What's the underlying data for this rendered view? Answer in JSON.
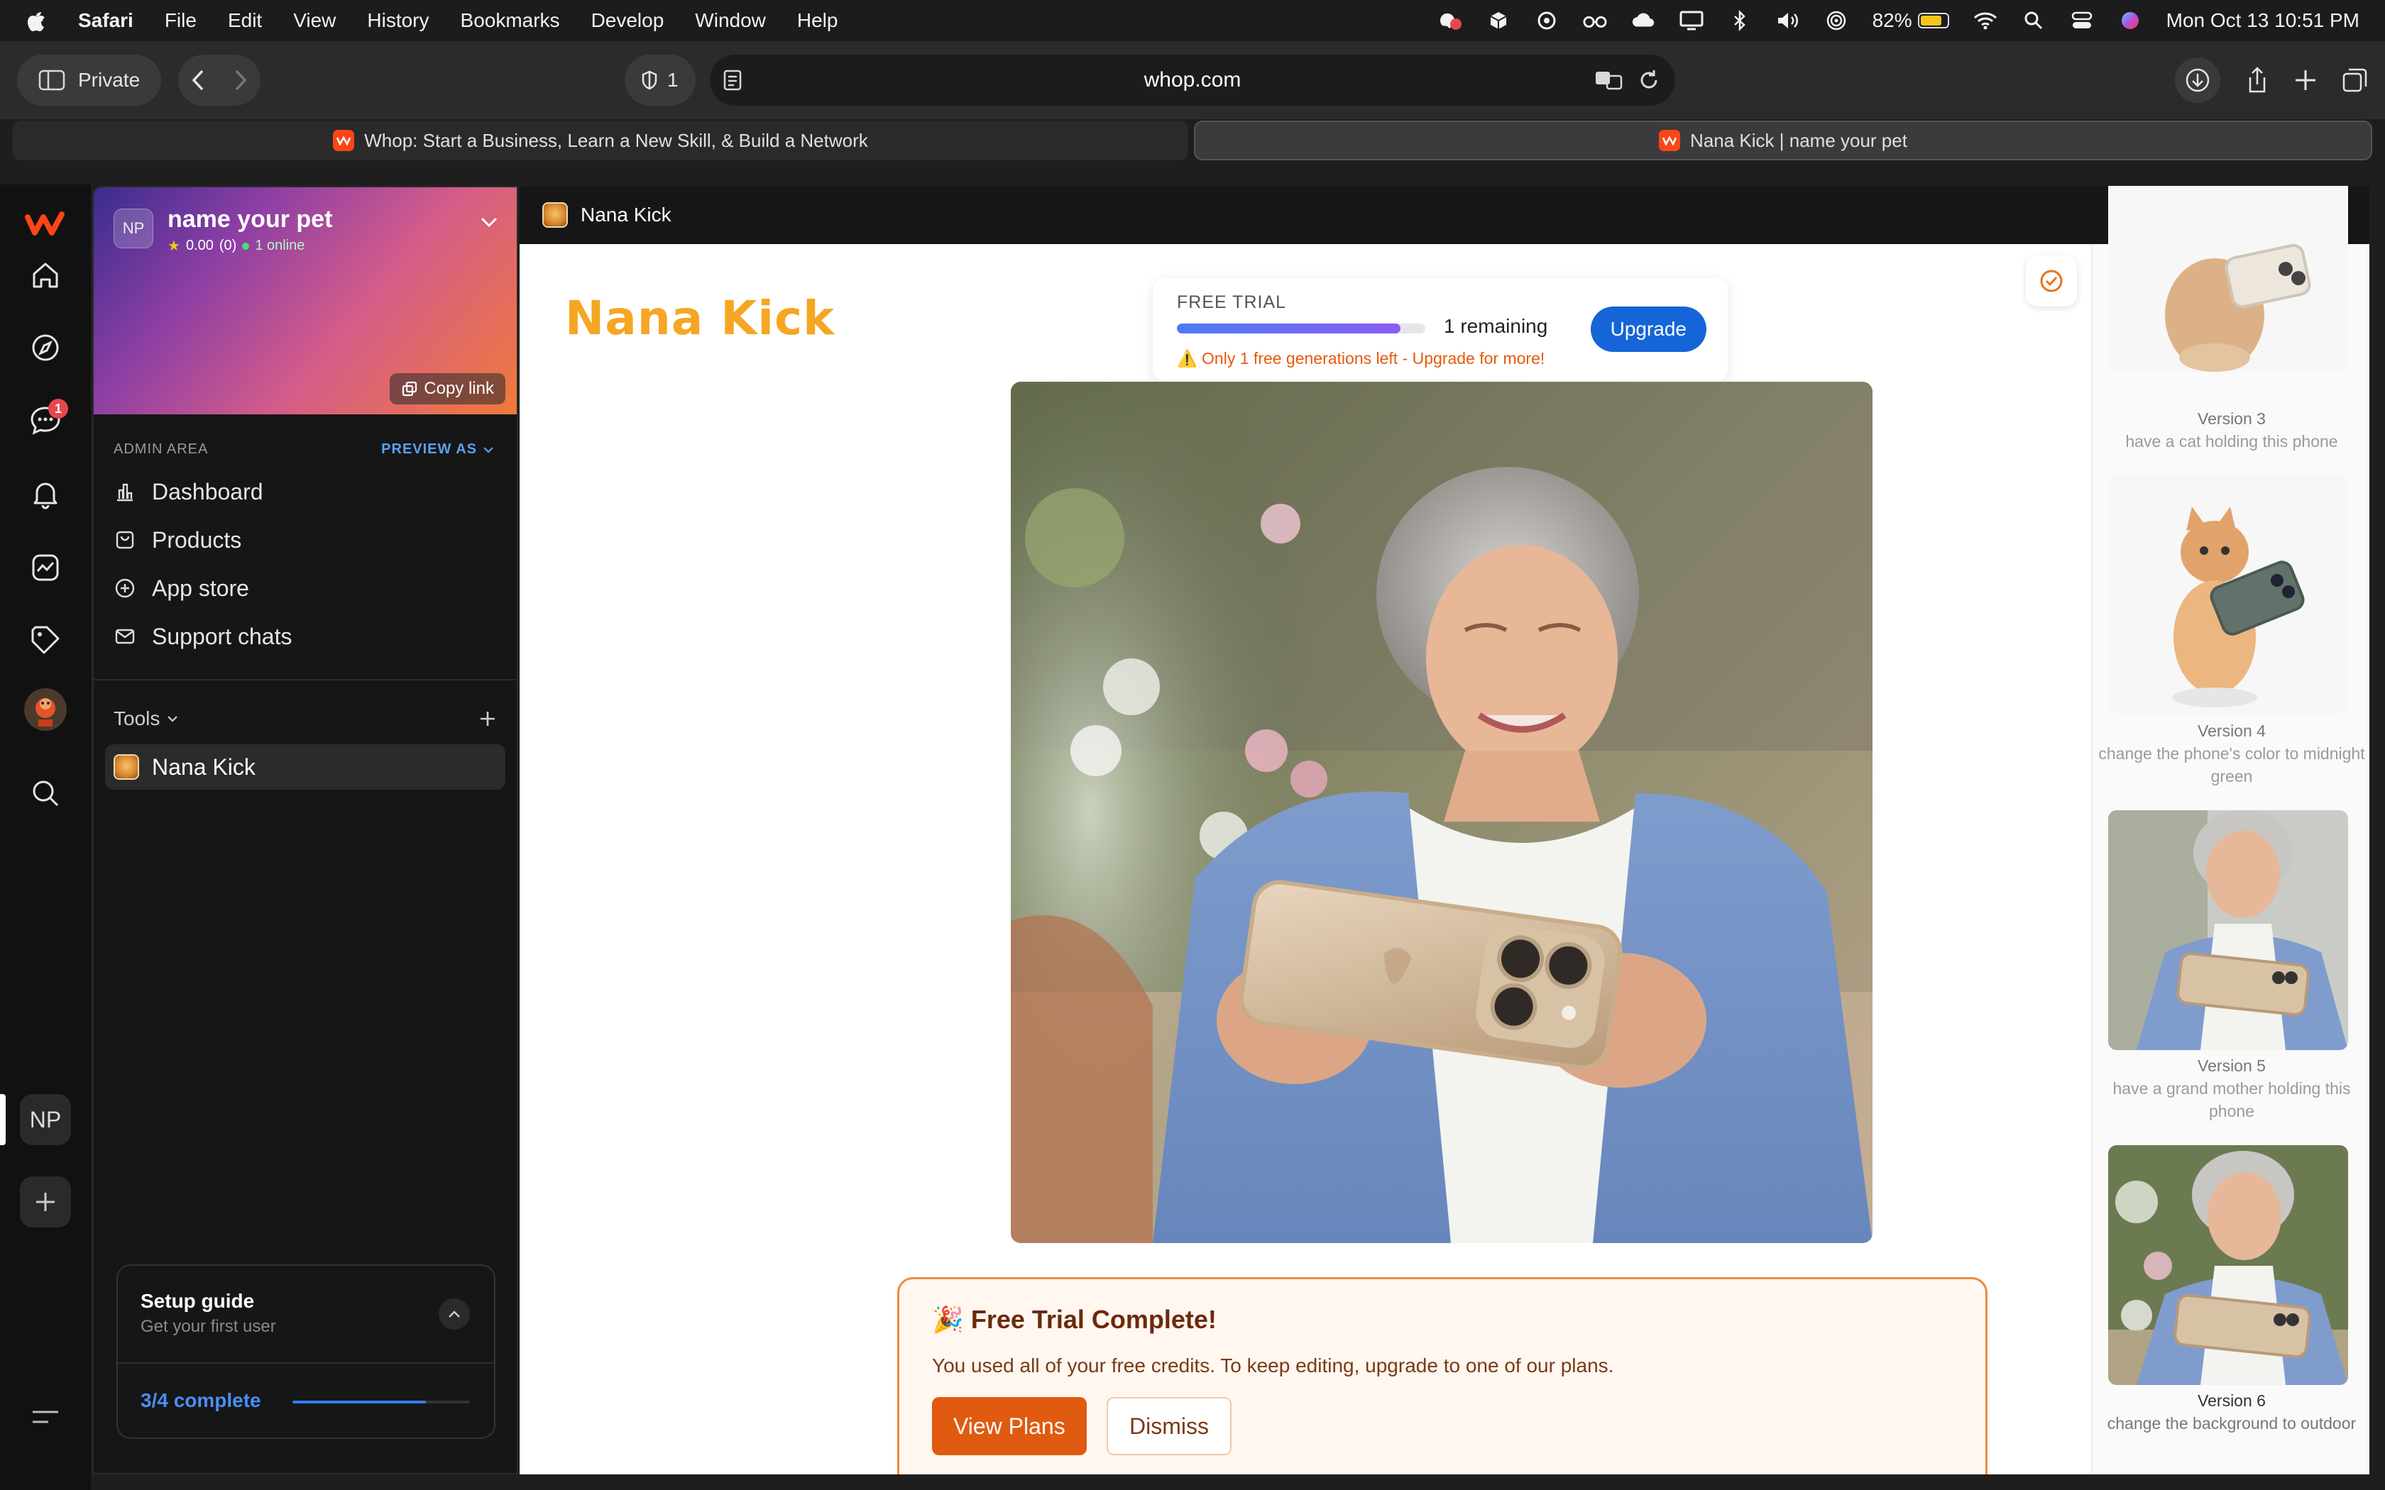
{
  "menubar": {
    "apple_icon": "apple-icon",
    "items": [
      "Safari",
      "File",
      "Edit",
      "View",
      "History",
      "Bookmarks",
      "Develop",
      "Window",
      "Help"
    ],
    "battery_percent": "82%",
    "datetime": "Mon Oct 13  10:51 PM"
  },
  "toolbar": {
    "private_label": "Private",
    "shield_count": "1",
    "url": "whop.com"
  },
  "tabs": [
    {
      "title": "Whop: Start a Business, Learn a New Skill, & Build a Network",
      "active": false
    },
    {
      "title": "Nana Kick | name your pet",
      "active": true
    }
  ],
  "rail": {
    "chat_badge": "1",
    "np_label": "NP"
  },
  "sidebar": {
    "community_initials": "NP",
    "community_name": "name your pet",
    "rating": "0.00",
    "reviews": "(0)",
    "online": "1 online",
    "copy_link": "Copy link",
    "admin_area": "ADMIN AREA",
    "preview_as": "PREVIEW AS",
    "nav": [
      {
        "label": "Dashboard",
        "icon": "bar-chart-icon"
      },
      {
        "label": "Products",
        "icon": "bag-icon"
      },
      {
        "label": "App store",
        "icon": "plus-circle-icon"
      },
      {
        "label": "Support chats",
        "icon": "mail-icon"
      }
    ],
    "tools_label": "Tools",
    "tool_items": [
      {
        "label": "Nana Kick"
      }
    ],
    "setup": {
      "title": "Setup guide",
      "subtitle": "Get your first user",
      "progress_label": "3/4 complete",
      "progress": 0.75
    }
  },
  "main": {
    "header_title": "Nana Kick",
    "brand": "Nana Kick",
    "trial": {
      "label": "FREE TRIAL",
      "remaining": "1 remaining",
      "warning": "⚠️ Only 1 free generations left - Upgrade for more!",
      "upgrade": "Upgrade",
      "progress": 0.9
    },
    "complete": {
      "title": "🎉 Free Trial Complete!",
      "text": "You used all of your free credits. To keep editing, upgrade to one of our plans.",
      "view_plans": "View Plans",
      "dismiss": "Dismiss"
    },
    "versions": [
      {
        "name": "Version 3",
        "desc": "have a cat holding this phone"
      },
      {
        "name": "Version 4",
        "desc": "change the phone's color to midnight green"
      },
      {
        "name": "Version 5",
        "desc": "have a grand mother holding this phone"
      },
      {
        "name": "Version 6",
        "desc": "change the background to outdoor"
      }
    ]
  },
  "colors": {
    "accent": "#f5a623",
    "upgrade_blue": "#1565d8",
    "view_plans": "#e05a10",
    "card_border": "#f08a3c"
  }
}
